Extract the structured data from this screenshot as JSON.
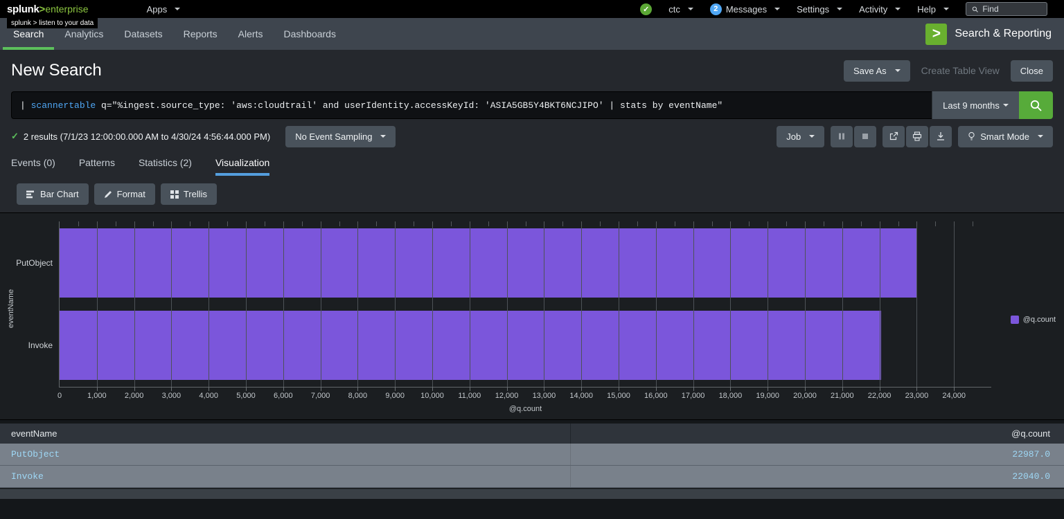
{
  "topbar": {
    "logo": {
      "brand": "splunk",
      "gt": ">",
      "product": "enterprise",
      "tagline": "splunk > listen to your data"
    },
    "apps_label": "Apps",
    "health_check_icon": "✓",
    "user_label": "ctc",
    "messages_count": "2",
    "messages_label": "Messages",
    "settings_label": "Settings",
    "activity_label": "Activity",
    "help_label": "Help",
    "find_placeholder": "Find"
  },
  "appnav": {
    "items": [
      {
        "label": "Search",
        "active": true
      },
      {
        "label": "Analytics"
      },
      {
        "label": "Datasets"
      },
      {
        "label": "Reports"
      },
      {
        "label": "Alerts"
      },
      {
        "label": "Dashboards"
      }
    ],
    "app_icon_glyph": ">",
    "app_title": "Search & Reporting"
  },
  "header": {
    "title": "New Search",
    "save_as_label": "Save As",
    "create_table_view_label": "Create Table View",
    "close_label": "Close"
  },
  "search_bar": {
    "query_pipe": "| ",
    "query_command": "scannertable",
    "query_rest": " q=\"%ingest.source_type: 'aws:cloudtrail' and userIdentity.accessKeyId: 'ASIA5GB5Y4BKT6NCJIPO' | stats by eventName\"",
    "time_range_label": "Last 9 months"
  },
  "status_bar": {
    "check_icon": "✓",
    "results_text": "2 results (7/1/23 12:00:00.000 AM to 4/30/24 4:56:44.000 PM)",
    "sampling_label": "No Event Sampling",
    "job_label": "Job",
    "smart_mode_label": "Smart Mode"
  },
  "tabs": [
    {
      "label": "Events (0)"
    },
    {
      "label": "Patterns"
    },
    {
      "label": "Statistics (2)"
    },
    {
      "label": "Visualization",
      "active": true
    }
  ],
  "viz_toolbar": {
    "chart_type_label": "Bar Chart",
    "format_label": "Format",
    "trellis_label": "Trellis"
  },
  "chart_data": {
    "type": "bar",
    "orientation": "horizontal",
    "categories": [
      "PutObject",
      "Invoke"
    ],
    "series": [
      {
        "name": "@q.count",
        "values": [
          22987.0,
          22040.0
        ]
      }
    ],
    "xlabel": "@q.count",
    "ylabel": "eventName",
    "xlim": [
      0,
      25000
    ],
    "tick_step": 1000,
    "minor_tick_step": 500,
    "grid": true,
    "legend_position": "right",
    "bar_color": "#7b56db",
    "legend": {
      "label": "@q.count",
      "color": "#7b56db"
    }
  },
  "table": {
    "columns": [
      "eventName",
      "@q.count"
    ],
    "rows": [
      [
        "PutObject",
        "22987.0"
      ],
      [
        "Invoke",
        "22040.0"
      ]
    ]
  }
}
